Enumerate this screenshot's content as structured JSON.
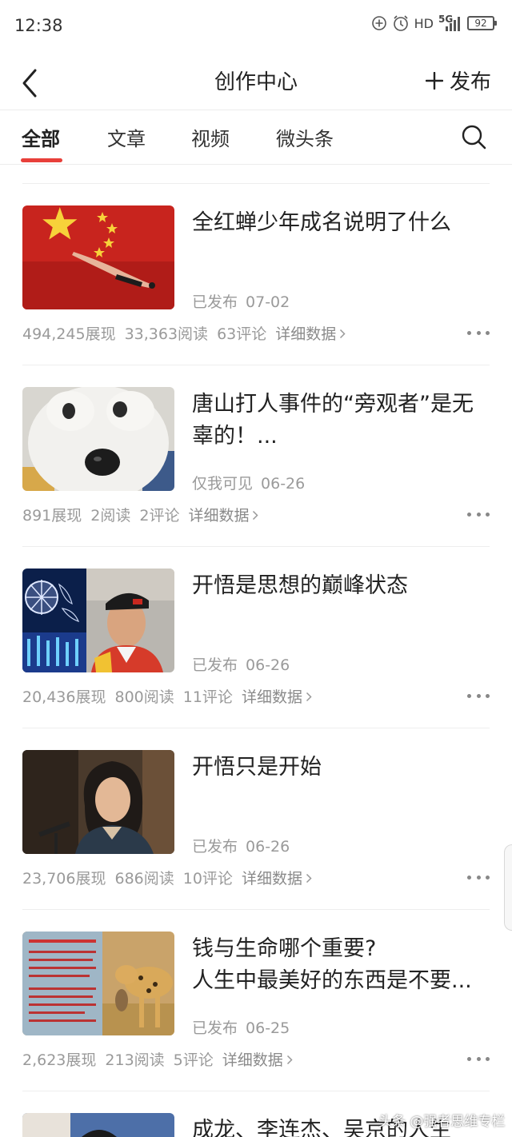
{
  "status_bar": {
    "time": "12:38",
    "network_hd": "HD",
    "network_5g": "5G",
    "battery": "92",
    "icons": [
      "add-circle-icon",
      "alarm-icon",
      "signal-icon",
      "battery-icon"
    ]
  },
  "header": {
    "title": "创作中心",
    "publish_label": "发布",
    "icons": [
      "back-icon",
      "plus-icon"
    ]
  },
  "tabs": {
    "items": [
      "全部",
      "文章",
      "视频",
      "微头条"
    ],
    "active_index": 0,
    "accent_color": "#e8403a",
    "search_icon": "search-icon"
  },
  "articles": [
    {
      "title_lines": [
        "全红蝉少年成名说明了什么"
      ],
      "status": "已发布",
      "date": "07-02",
      "views": "494,245展现",
      "reads": "33,363阅读",
      "comments": "63评论",
      "detail_label": "详细数据"
    },
    {
      "title_lines": [
        "唐山打人事件的“旁观者”是无",
        "辜的！..."
      ],
      "status": "仅我可见",
      "date": "06-26",
      "views": "891展现",
      "reads": "2阅读",
      "comments": "2评论",
      "detail_label": "详细数据"
    },
    {
      "title_lines": [
        "开悟是思想的巅峰状态"
      ],
      "status": "已发布",
      "date": "06-26",
      "views": "20,436展现",
      "reads": "800阅读",
      "comments": "11评论",
      "detail_label": "详细数据"
    },
    {
      "title_lines": [
        "开悟只是开始"
      ],
      "status": "已发布",
      "date": "06-26",
      "views": "23,706展现",
      "reads": "686阅读",
      "comments": "10评论",
      "detail_label": "详细数据"
    },
    {
      "title_lines": [
        "钱与生命哪个重要?",
        "人生中最美好的东西是不要..."
      ],
      "status": "已发布",
      "date": "06-25",
      "views": "2,623展现",
      "reads": "213阅读",
      "comments": "5评论",
      "detail_label": "详细数据"
    },
    {
      "title_lines": [
        "成龙、李连杰、吴京的人生"
      ]
    }
  ],
  "watermark": "头条 @强者思维专栏"
}
